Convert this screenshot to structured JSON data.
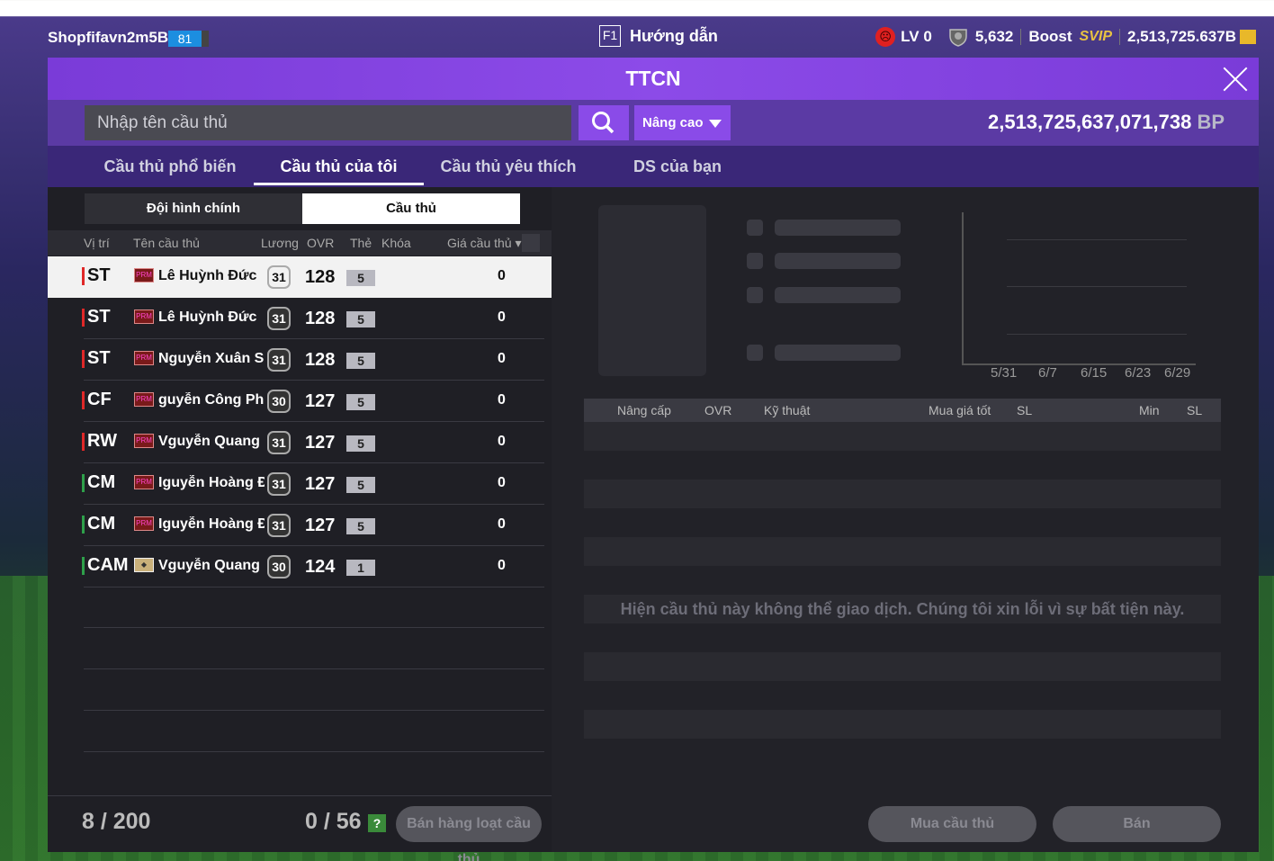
{
  "topbar": {
    "username": "Shopfifavn2m5Bp",
    "level": "81",
    "guide_key": "F1",
    "guide_label": "Hướng dẫn",
    "lv": "LV 0",
    "trophies": "5,632",
    "boost": "Boost",
    "svip": "SVIP",
    "balance": "2,513,725.637B"
  },
  "window": {
    "title": "TTCN"
  },
  "search": {
    "placeholder": "Nhập tên cầu thủ",
    "advanced": "Nâng cao",
    "bp_value": "2,513,725,637,071,738",
    "bp_unit": "BP"
  },
  "tabs": [
    "Cầu thủ phổ biến",
    "Cầu thủ của tôi",
    "Cầu thủ yêu thích",
    "DS của bạn"
  ],
  "subtabs": [
    "Đội hình chính",
    "Cầu thủ"
  ],
  "columns": {
    "pos": "Vị trí",
    "name": "Tên cầu thủ",
    "salary": "Lương",
    "ovr": "OVR",
    "card": "Thẻ",
    "lock": "Khóa",
    "price": "Giá cầu thủ"
  },
  "players": [
    {
      "pos": "ST",
      "badge": "PRM",
      "name": "Lê Huỳnh Đức",
      "salary": "31",
      "ovr": "128",
      "card": "5",
      "price": "0"
    },
    {
      "pos": "ST",
      "badge": "PRM",
      "name": "Lê Huỳnh Đức",
      "salary": "31",
      "ovr": "128",
      "card": "5",
      "price": "0"
    },
    {
      "pos": "ST",
      "badge": "PRM",
      "name": "Nguyễn Xuân Son",
      "salary": "31",
      "ovr": "128",
      "card": "5",
      "price": "0"
    },
    {
      "pos": "CF",
      "badge": "PRM",
      "name": "guyễn Công Phượ",
      "salary": "30",
      "ovr": "127",
      "card": "5",
      "price": "0"
    },
    {
      "pos": "RW",
      "badge": "PRM",
      "name": "Vguyễn Quang Hả",
      "salary": "31",
      "ovr": "127",
      "card": "5",
      "price": "0"
    },
    {
      "pos": "CM",
      "badge": "PRM",
      "name": "Iguyễn Hoàng Đức",
      "salary": "31",
      "ovr": "127",
      "card": "5",
      "price": "0"
    },
    {
      "pos": "CM",
      "badge": "PRM",
      "name": "Iguyễn Hoàng Đức",
      "salary": "31",
      "ovr": "127",
      "card": "5",
      "price": "0"
    },
    {
      "pos": "CAM",
      "badge": "",
      "name": "Vguyễn Quang Hả",
      "salary": "30",
      "ovr": "124",
      "card": "1",
      "price": "0"
    }
  ],
  "footer": {
    "count": "8 / 200",
    "selected": "0 / 56",
    "help": "?",
    "bulk_sell": "Bán hàng loạt cầu thủ"
  },
  "chart": {
    "x_labels": [
      "5/31",
      "6/7",
      "6/15",
      "6/23",
      "6/29"
    ]
  },
  "upgrade_columns": [
    "Nâng cấp",
    "OVR",
    "Kỹ thuật",
    "Mua giá tốt",
    "SL",
    "Min",
    "SL"
  ],
  "notice": "Hiện cầu thủ này không thể giao dịch. Chúng tôi xin lỗi vì sự bất tiện này.",
  "actions": {
    "buy": "Mua cầu thủ",
    "sell": "Bán"
  },
  "colors": {
    "accent": "#8a4be8",
    "pos_attack": "#e02828",
    "pos_mid": "#2ea04a"
  }
}
